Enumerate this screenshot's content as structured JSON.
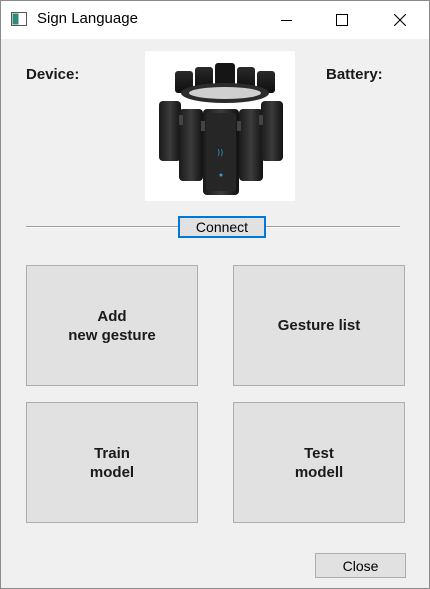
{
  "window": {
    "title": "Sign Language",
    "app_icon": "window-app-icon",
    "controls": {
      "minimize_icon": "minimize-icon",
      "maximize_icon": "maximize-icon",
      "close_icon": "close-icon"
    }
  },
  "header": {
    "device_label": "Device:",
    "battery_label": "Battery:",
    "device_image": "armband-device-image"
  },
  "connect": {
    "label": "Connect"
  },
  "actions": {
    "add_gesture": "Add\nnew gesture",
    "gesture_list": "Gesture list",
    "train_model": "Train\nmodel",
    "test_model": "Test\nmodell"
  },
  "footer": {
    "close_label": "Close"
  },
  "colors": {
    "window_bg": "#f0f0f0",
    "button_bg": "#e1e1e1",
    "button_border": "#adadad",
    "focus_border": "#0078d7"
  }
}
